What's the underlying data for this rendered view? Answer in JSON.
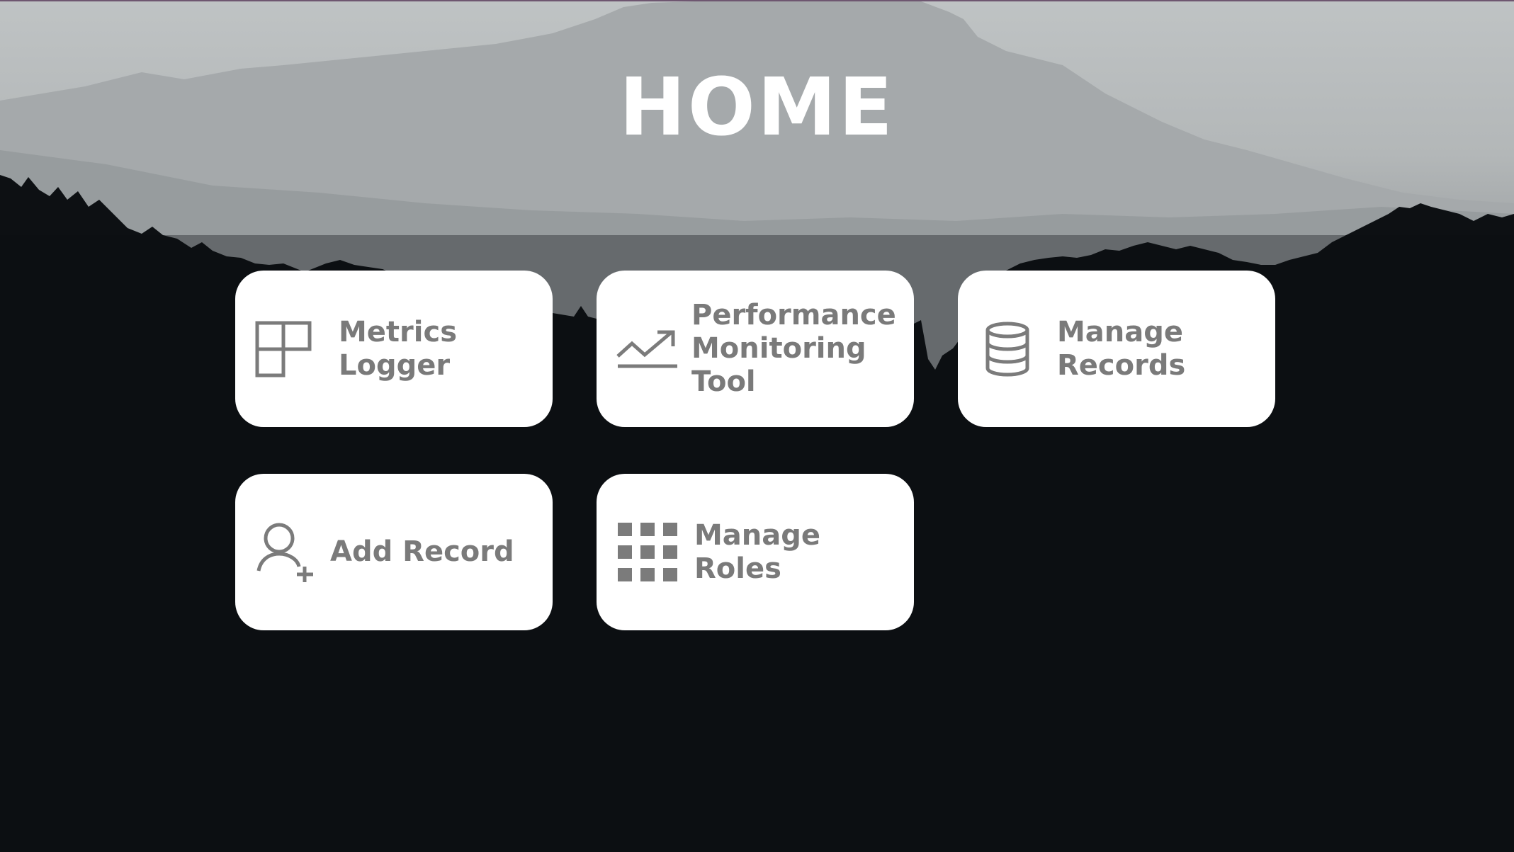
{
  "page": {
    "title": "HOME"
  },
  "tiles": [
    {
      "label": "Metrics Logger",
      "icon": "grid-layout-icon"
    },
    {
      "label": "Performance Monitoring Tool",
      "label_lines": [
        "Performance",
        "Monitoring",
        "Tool"
      ],
      "icon": "trending-up-icon"
    },
    {
      "label": "Manage Records",
      "label_lines": [
        "Manage",
        "Records"
      ],
      "icon": "database-icon"
    },
    {
      "label": "Add Record",
      "icon": "add-user-icon"
    },
    {
      "label": "Manage Roles",
      "icon": "apps-grid-icon"
    }
  ],
  "colors": {
    "tile_background": "#ffffff",
    "tile_text": "#7a7a7a",
    "title_text": "#ffffff",
    "accent_top_border": "#6e5670"
  }
}
